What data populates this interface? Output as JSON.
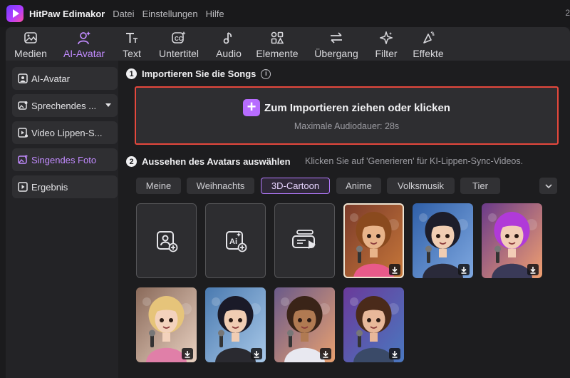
{
  "app": {
    "name": "HitPaw Edimakor",
    "menu": [
      "Datei",
      "Einstellungen",
      "Hilfe"
    ],
    "corner_text": "2"
  },
  "toolbar": [
    {
      "label": "Medien",
      "icon": "media-icon",
      "active": false
    },
    {
      "label": "AI-Avatar",
      "icon": "avatar-icon",
      "active": true
    },
    {
      "label": "Text",
      "icon": "text-icon",
      "active": false
    },
    {
      "label": "Untertitel",
      "icon": "subtitle-icon",
      "active": false
    },
    {
      "label": "Audio",
      "icon": "audio-icon",
      "active": false
    },
    {
      "label": "Elemente",
      "icon": "elements-icon",
      "active": false
    },
    {
      "label": "Übergang",
      "icon": "transition-icon",
      "active": false
    },
    {
      "label": "Filter",
      "icon": "filter-icon",
      "active": false
    },
    {
      "label": "Effekte",
      "icon": "effects-icon",
      "active": false
    }
  ],
  "sidebar": [
    {
      "label": "AI-Avatar",
      "icon": "avatar-box-icon",
      "active": false
    },
    {
      "label": "Sprechendes ...",
      "icon": "talking-photo-icon",
      "active": false,
      "dropdown": true
    },
    {
      "label": "Video Lippen-S...",
      "icon": "video-lipsync-icon",
      "active": false
    },
    {
      "label": "Singendes Foto",
      "icon": "singing-photo-icon",
      "active": true
    },
    {
      "label": "Ergebnis",
      "icon": "result-icon",
      "active": false
    }
  ],
  "step1": {
    "number": "1",
    "title": "Importieren Sie die Songs",
    "info": "i"
  },
  "import": {
    "plus": "+",
    "title": "Zum Importieren ziehen oder klicken",
    "subtitle": "Maximale Audiodauer: 28s"
  },
  "step2": {
    "number": "2",
    "title": "Aussehen des Avatars auswählen",
    "hint": "Klicken Sie auf 'Generieren' für KI-Lippen-Sync-Videos."
  },
  "categories": [
    "Meine",
    "Weihnachts",
    "3D-Cartoon",
    "Anime",
    "Volksmusik",
    "Tier"
  ],
  "selected_category": "3D-Cartoon",
  "tools": [
    {
      "name": "upload-photo-tile",
      "icon": "add-photo-icon"
    },
    {
      "name": "ai-generate-tile",
      "icon": "ai-add-icon"
    },
    {
      "name": "record-video-tile",
      "icon": "video-record-icon"
    }
  ],
  "avatars": [
    {
      "name": "avatar-curly-hair-girl",
      "hair": "#8a4a1e",
      "skin": "#e8b48a",
      "outfit": "#e85a8a",
      "bg1": "#7a3a2a",
      "bg2": "#c8783a",
      "selected": true
    },
    {
      "name": "avatar-black-hair-girl",
      "hair": "#1d1d2a",
      "skin": "#f0cdb3",
      "outfit": "#2a2a3a",
      "bg1": "#2f5fa8",
      "bg2": "#7fa8e0",
      "selected": false
    },
    {
      "name": "avatar-purple-hair-girl",
      "hair": "#b03ad8",
      "skin": "#f2cdb6",
      "outfit": "#3a3a58",
      "bg1": "#6a3a8a",
      "bg2": "#f0a070",
      "selected": false
    },
    {
      "name": "avatar-blonde-girl",
      "hair": "#e6c47a",
      "skin": "#f3d2bc",
      "outfit": "#e07fa8",
      "bg1": "#8a6a5a",
      "bg2": "#e8d0c0",
      "selected": false
    },
    {
      "name": "avatar-dark-hair-girl-mic",
      "hair": "#1a1a28",
      "skin": "#f0cdb3",
      "outfit": "#2a2a30",
      "bg1": "#4a7ab0",
      "bg2": "#a8c8e8",
      "selected": false
    },
    {
      "name": "avatar-afro-girl",
      "hair": "#3a2418",
      "skin": "#b07a52",
      "outfit": "#e8e8f0",
      "bg1": "#6a5a8a",
      "bg2": "#e8a070",
      "selected": false
    },
    {
      "name": "avatar-boy-singer",
      "hair": "#4a2a1a",
      "skin": "#e8b89a",
      "outfit": "#3a4a68",
      "bg1": "#6a3a9a",
      "bg2": "#4a78c0",
      "selected": false
    }
  ]
}
